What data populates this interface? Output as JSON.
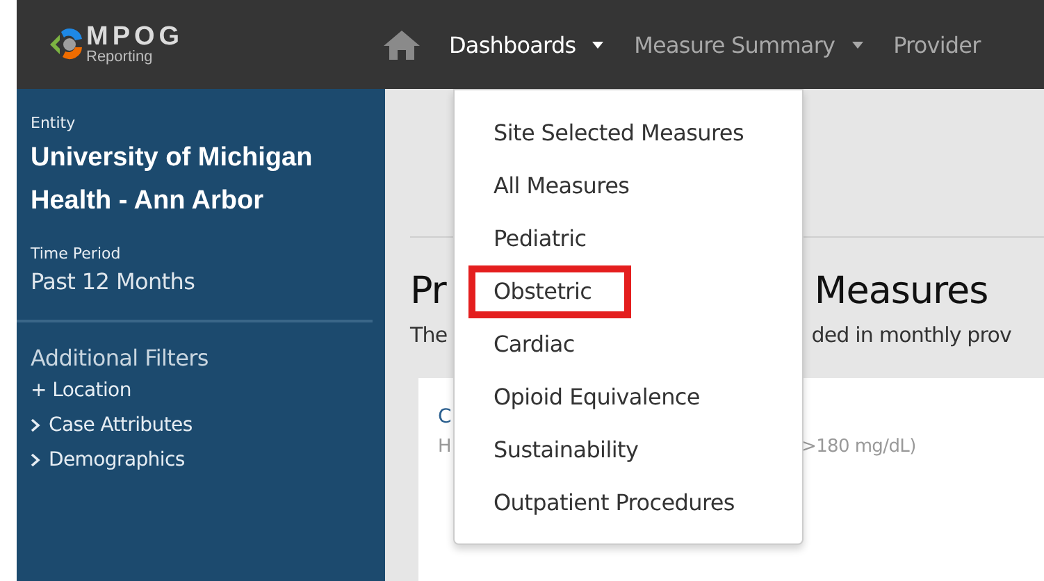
{
  "logo": {
    "title": "MPOG",
    "subtitle": "Reporting"
  },
  "nav": [
    {
      "label": "Dashboards",
      "selected": true,
      "caret": true
    },
    {
      "label": "Measure Summary",
      "selected": false,
      "caret": true
    },
    {
      "label": "Provider",
      "selected": false,
      "caret": false
    }
  ],
  "sidebar": {
    "entity_label": "Entity",
    "entity": "University of Michigan Health - Ann Arbor",
    "period_label": "Time Period",
    "period": "Past 12 Months",
    "filters_title": "Additional Filters",
    "filters": [
      {
        "kind": "add",
        "label": "+ Location"
      },
      {
        "kind": "expand",
        "label": "Case Attributes"
      },
      {
        "kind": "expand",
        "label": "Demographics"
      }
    ]
  },
  "main": {
    "heading": [
      "Pr",
      "Measures"
    ],
    "description": [
      "The",
      "ded in monthly prov"
    ],
    "card": {
      "title": "C",
      "subtitle": [
        "H",
        ">180 mg/dL)"
      ]
    }
  },
  "dropdown": [
    {
      "label": "Site Selected Measures",
      "highlighted": false
    },
    {
      "label": "All Measures",
      "highlighted": false
    },
    {
      "label": "Pediatric",
      "highlighted": false
    },
    {
      "label": "Obstetric",
      "highlighted": true
    },
    {
      "label": "Cardiac",
      "highlighted": false
    },
    {
      "label": "Opioid Equivalence",
      "highlighted": false
    },
    {
      "label": "Sustainability",
      "highlighted": false
    },
    {
      "label": "Outpatient Procedures",
      "highlighted": false
    }
  ]
}
